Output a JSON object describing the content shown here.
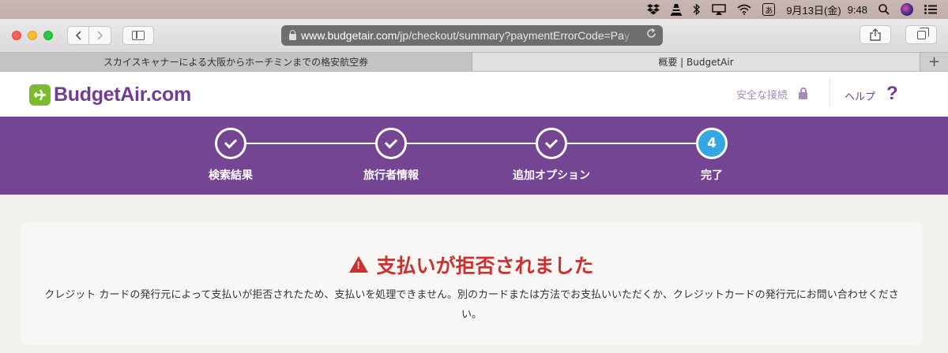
{
  "menubar": {
    "date": "9月13日(金)",
    "time": "9:48",
    "ime": "あ",
    "icons": [
      "dropbox-icon",
      "vlc-icon",
      "bluetooth-icon",
      "airplay-icon",
      "wifi-icon",
      "ime-icon",
      "search-icon",
      "siri-icon",
      "notification-center-icon"
    ]
  },
  "browser": {
    "url_domain": "www.budgetair.com",
    "url_path": "/jp/checkout/summary?paymentErrorCode=Pa",
    "url_fade": "y",
    "tabs": [
      {
        "label": "スカイスキャナーによる大阪からホーチミンまでの格安航空券",
        "active": false
      },
      {
        "label": "概要 | BudgetAir",
        "active": true
      }
    ],
    "newtab": "+"
  },
  "header": {
    "logo_text": "BudgetAir.com",
    "secure_label": "安全な接続",
    "help_label": "ヘルプ",
    "help_glyph": "?"
  },
  "steps": [
    {
      "label": "検索結果",
      "state": "done"
    },
    {
      "label": "旅行者情報",
      "state": "done"
    },
    {
      "label": "追加オプション",
      "state": "done"
    },
    {
      "label": "完了",
      "state": "current",
      "number": "4"
    }
  ],
  "error": {
    "title": "支払いが拒否されました",
    "message": "クレジット カードの発行元によって支払いが拒否されたため、支払いを処理できません。別のカードまたは方法でお支払いいただくか、クレジットカードの発行元にお問い合わせください。"
  },
  "colors": {
    "brand_purple": "#734593",
    "logo_green": "#7dbb2e",
    "current_step_blue": "#33a7e3",
    "error_red": "#c9322e"
  }
}
